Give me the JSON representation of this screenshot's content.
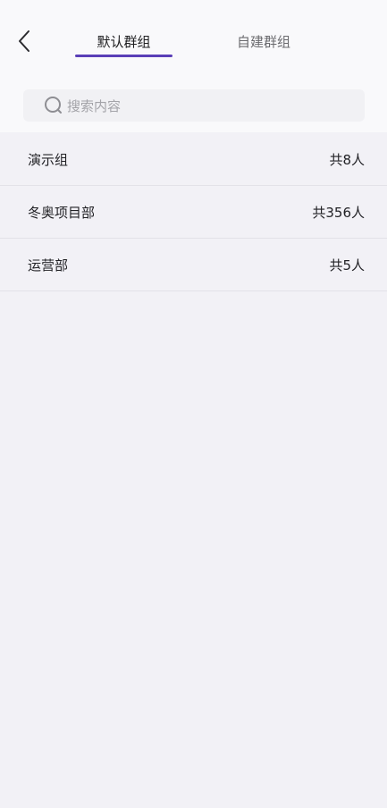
{
  "header": {
    "back_icon": "chevron-left-icon",
    "tabs": [
      {
        "label": "默认群组",
        "active": true
      },
      {
        "label": "自建群组",
        "active": false
      }
    ],
    "accent_color": "#5a3fb7"
  },
  "search": {
    "icon": "search-icon",
    "placeholder": "搜索内容"
  },
  "groups": [
    {
      "name": "演示组",
      "count": "共8人"
    },
    {
      "name": "冬奥项目部",
      "count": "共356人"
    },
    {
      "name": "运营部",
      "count": "共5人"
    }
  ]
}
